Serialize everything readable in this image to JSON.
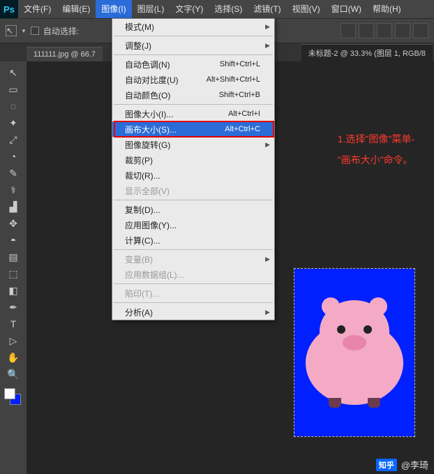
{
  "menubar": {
    "items": [
      "文件(F)",
      "编辑(E)",
      "图像(I)",
      "图层(L)",
      "文字(Y)",
      "选择(S)",
      "滤镜(T)",
      "视图(V)",
      "窗口(W)",
      "帮助(H)"
    ],
    "open_index": 2
  },
  "optbar": {
    "auto_select": "自动选择:"
  },
  "tabs": {
    "left": "111111.jpg @ 66.7",
    "right": "未标题-2 @ 33.3% (图层 1, RGB/8"
  },
  "dropdown": [
    {
      "label": "模式(M)",
      "sub": true
    },
    {
      "sep": true
    },
    {
      "label": "调整(J)",
      "sub": true
    },
    {
      "sep": true
    },
    {
      "label": "自动色调(N)",
      "sc": "Shift+Ctrl+L"
    },
    {
      "label": "自动对比度(U)",
      "sc": "Alt+Shift+Ctrl+L"
    },
    {
      "label": "自动颜色(O)",
      "sc": "Shift+Ctrl+B"
    },
    {
      "sep": true
    },
    {
      "label": "图像大小(I)...",
      "sc": "Alt+Ctrl+I"
    },
    {
      "label": "画布大小(S)...",
      "sc": "Alt+Ctrl+C",
      "hl": true,
      "box": true
    },
    {
      "label": "图像旋转(G)",
      "sub": true
    },
    {
      "label": "裁剪(P)"
    },
    {
      "label": "裁切(R)..."
    },
    {
      "label": "显示全部(V)",
      "disabled": true
    },
    {
      "sep": true
    },
    {
      "label": "复制(D)..."
    },
    {
      "label": "应用图像(Y)..."
    },
    {
      "label": "计算(C)..."
    },
    {
      "sep": true
    },
    {
      "label": "变量(B)",
      "sub": true,
      "disabled": true
    },
    {
      "label": "应用数据组(L)...",
      "disabled": true
    },
    {
      "sep": true
    },
    {
      "label": "陷印(T)...",
      "disabled": true
    },
    {
      "sep": true
    },
    {
      "label": "分析(A)",
      "sub": true
    }
  ],
  "annotation": {
    "line1": "1.选择\"图像\"菜单-",
    "line2": "\"画布大小\"命令。"
  },
  "credit": {
    "brand": "知乎",
    "author": "@李琦"
  },
  "tools": [
    "↖",
    "▭",
    "◌",
    "✦",
    "⤢",
    "◔",
    "✎",
    "⚕",
    "▟",
    "✥",
    "◓",
    "▤",
    "⬚",
    "◧",
    "✒",
    "T",
    "▷",
    "✋",
    "🔍"
  ]
}
